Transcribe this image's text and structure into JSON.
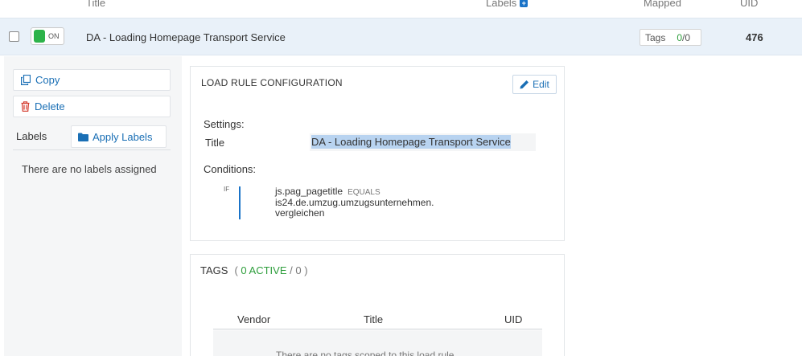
{
  "header": {
    "title_col": "Title",
    "labels_col": "Labels",
    "labels_add_icon": "plus-square-icon",
    "mapped_col": "Mapped",
    "uid_col": "UID"
  },
  "rule": {
    "toggle_label": "ON",
    "title": "DA - Loading Homepage Transport Service",
    "tags_label": "Tags",
    "tags_active": "0",
    "tags_total": "/0",
    "uid": "476"
  },
  "actions": {
    "copy_label": "Copy",
    "delete_label": "Delete",
    "labels_label": "Labels",
    "apply_labels_label": "Apply Labels",
    "no_labels_text": "There are no labels assigned"
  },
  "config": {
    "panel_title": "LOAD RULE CONFIGURATION",
    "edit_label": "Edit",
    "settings_label": "Settings:",
    "title_label": "Title",
    "title_value": "DA - Loading Homepage Transport Service",
    "conditions_label": "Conditions:",
    "if_label": "IF",
    "condition_variable": "js.pag_pagetitle",
    "condition_operator": "EQUALS",
    "condition_value": "is24.de.umzug.umzugsunternehmen.vergleichen"
  },
  "tags": {
    "title": "TAGS",
    "open_paren": "(",
    "active_text": "0 ACTIVE",
    "total_text": "/ 0",
    "close_paren": ")",
    "columns": [
      "Vendor",
      "Title",
      "UID"
    ],
    "empty_text": "There are no tags scoped to this load rule"
  },
  "colors": {
    "accent": "#1a73c8",
    "active_green": "#2db34a",
    "selected_row": "#e9f1f9",
    "delete_red": "#d43a2c"
  }
}
